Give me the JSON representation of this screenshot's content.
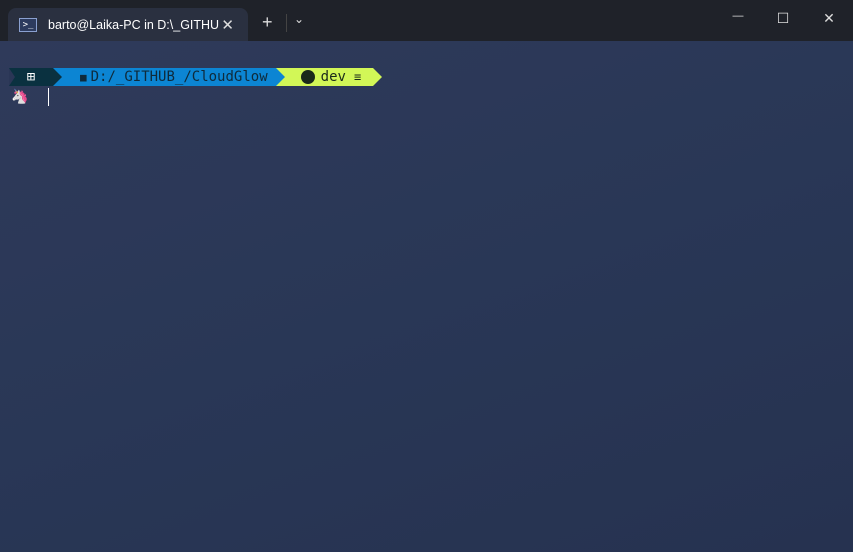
{
  "window": {
    "tab_title": "barto@Laika-PC in D:\\_GITHU",
    "tab_icon": "powershell-icon",
    "new_tab": "+",
    "dropdown": "⌄",
    "minimize": "—",
    "maximize": "☐",
    "close": "✕",
    "tab_close": "✕"
  },
  "prompt": {
    "os_icon": "⊞",
    "folder_icon": "■",
    "path": "D:/_GITHUB_/CloudGlow",
    "git_icon": "github-icon",
    "branch": "dev",
    "status": "≡",
    "user_icon": "🦄"
  },
  "colors": {
    "os_segment": "#0a3140",
    "path_segment": "#0c85d3",
    "git_segment": "#d2f757"
  }
}
